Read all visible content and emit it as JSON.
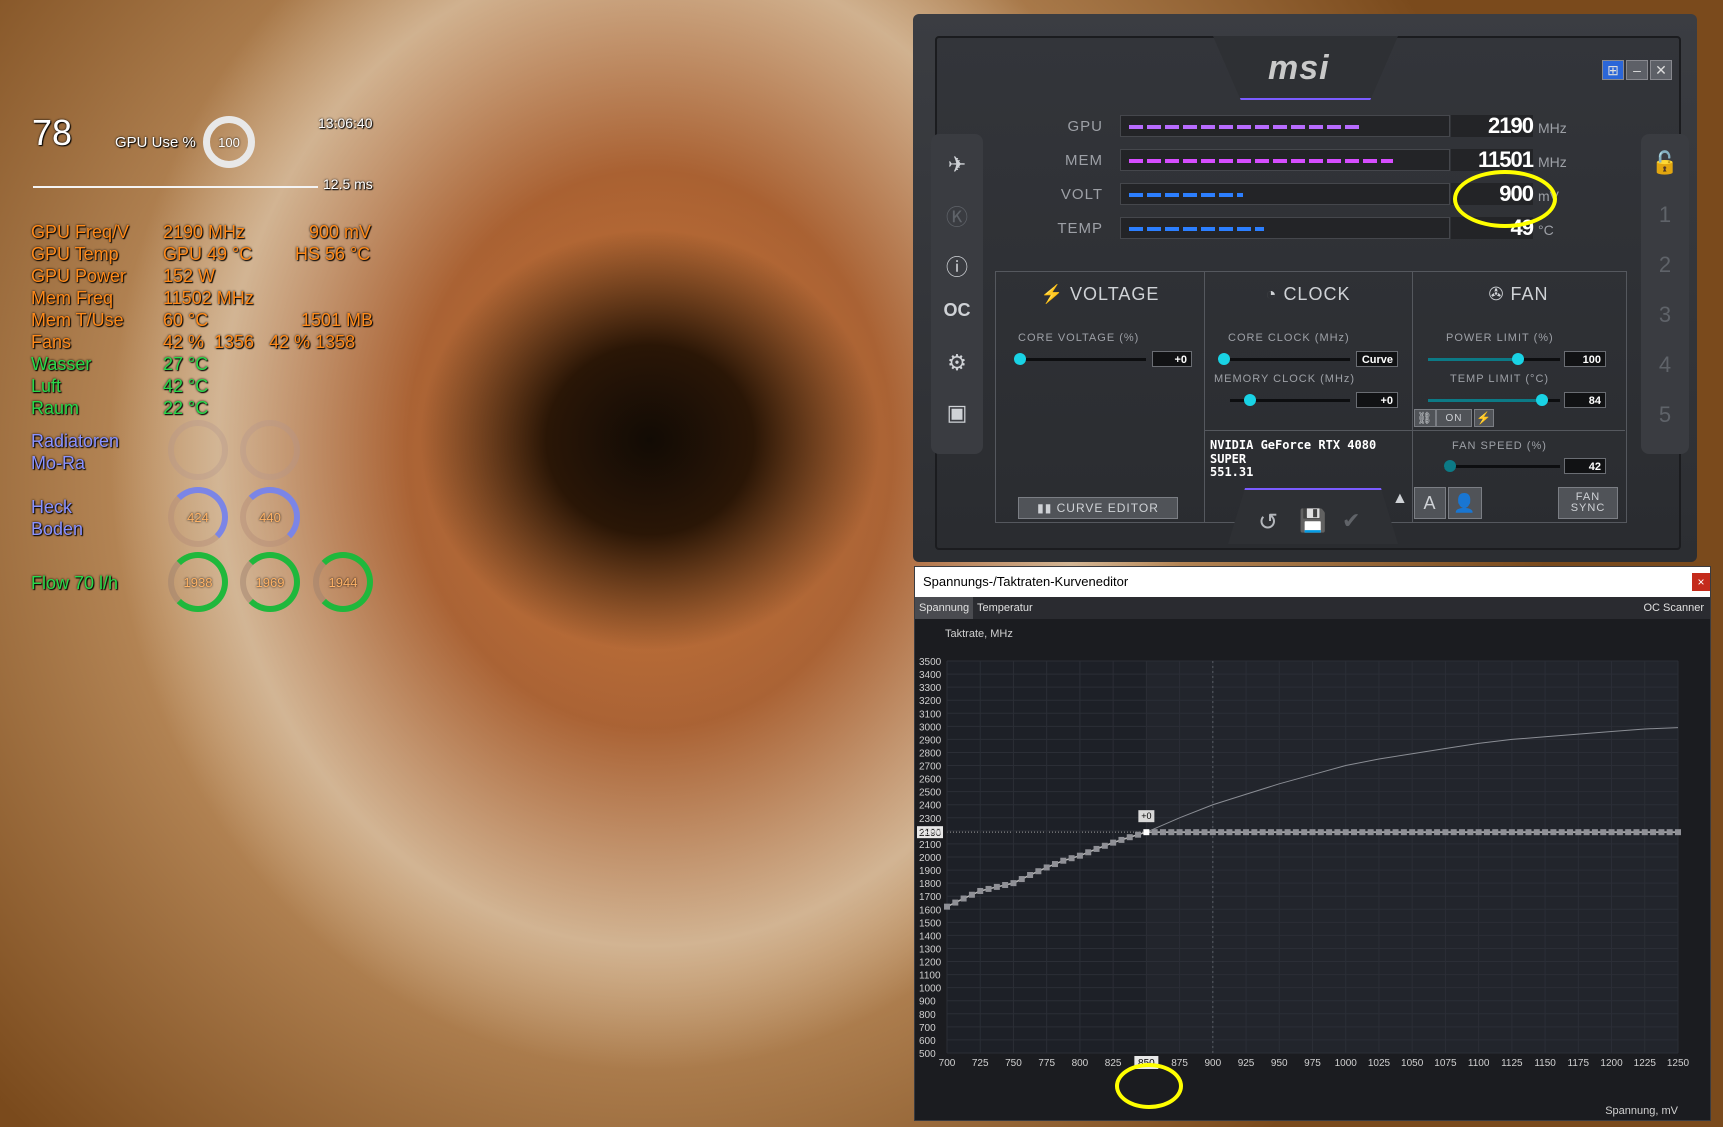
{
  "osd": {
    "fps": "78",
    "gpu_use_label": "GPU Use %",
    "gpu_use_value": "100",
    "time": "13:06:40",
    "frametime": "12.5 ms",
    "rows": [
      {
        "label": "GPU Freq/V",
        "v1": "2190 MHz",
        "v2": "900 mV",
        "color": "orange"
      },
      {
        "label": "GPU Temp",
        "v1": "GPU 49 °C",
        "v2": "HS 56 °C",
        "color": "orange"
      },
      {
        "label": "GPU Power",
        "v1": "152 W",
        "v2": "",
        "color": "orange"
      },
      {
        "label": "Mem Freq",
        "v1": "11502 MHz",
        "v2": "",
        "color": "orange"
      },
      {
        "label": "Mem T/Use",
        "v1": "60 °C",
        "v2": "1501 MB",
        "color": "orange"
      },
      {
        "label": "Fans",
        "v1": "42 %  1356   42 % 1358",
        "v2": "",
        "color": "orange"
      },
      {
        "label": "Wasser",
        "v1": "27 °C",
        "v2": "",
        "color": "green"
      },
      {
        "label": "Luft",
        "v1": "42 °C",
        "v2": "",
        "color": "green"
      },
      {
        "label": "Raum",
        "v1": "22 °C",
        "v2": "",
        "color": "green"
      }
    ],
    "radiatoren_label": "Radiatoren",
    "mora_label": "Mo-Ra",
    "heck_label": "Heck",
    "boden_label": "Boden",
    "heck_values": [
      "424",
      "440"
    ],
    "flow_label": "Flow 70 l/h",
    "flow_values": [
      "1938",
      "1969",
      "1944"
    ]
  },
  "afterburner": {
    "logo": "msi",
    "monitors": [
      {
        "label": "GPU",
        "value": "2190",
        "unit": "MHz",
        "fill": 0.77,
        "color": "#b86cff"
      },
      {
        "label": "MEM",
        "value": "11501",
        "unit": "MHz",
        "fill": 0.88,
        "color": "#d64dff"
      },
      {
        "label": "VOLT",
        "value": "900",
        "unit": "mV",
        "fill": 0.38,
        "color": "#2c7fff"
      },
      {
        "label": "TEMP",
        "value": "49",
        "unit": "°C",
        "fill": 0.45,
        "color": "#2c7fff"
      }
    ],
    "voltage_head": "VOLTAGE",
    "clock_head": "CLOCK",
    "fan_head": "FAN",
    "core_voltage_label": "CORE VOLTAGE (%)",
    "core_voltage_value": "+0",
    "core_clock_label": "CORE CLOCK (MHz)",
    "core_clock_value": "Curve",
    "memory_clock_label": "MEMORY CLOCK (MHz)",
    "memory_clock_value": "+0",
    "power_limit_label": "POWER LIMIT (%)",
    "power_limit_value": "100",
    "temp_limit_label": "TEMP LIMIT (°C)",
    "temp_limit_value": "84",
    "link_on": "ON",
    "fan_speed_label": "FAN SPEED (%)",
    "fan_speed_value": "42",
    "gpu_name": "NVIDIA GeForce RTX 4080 SUPER",
    "driver": "551.31",
    "curve_editor_btn": "CURVE EDITOR",
    "fan_sync_btn": "FAN\nSYNC",
    "profiles": [
      "1",
      "2",
      "3",
      "4",
      "5"
    ],
    "accent": "#19d3e5"
  },
  "curve_editor": {
    "title": "Spannungs-/Taktraten-Kurveneditor",
    "tab_voltage": "Spannung",
    "tab_temperature": "Temperatur",
    "oc_scanner": "OC Scanner",
    "close": "×",
    "y_axis_label": "Taktrate, MHz",
    "x_axis_label": "Spannung, mV",
    "current_clock": "2190",
    "current_voltage": "850",
    "offset_label": "+0"
  },
  "chart_data": {
    "type": "line",
    "title": "Spannungs-/Taktraten-Kurveneditor",
    "xlabel": "Spannung, mV",
    "ylabel": "Taktrate, MHz",
    "xlim": [
      700,
      1250
    ],
    "ylim": [
      500,
      3500
    ],
    "x_ticks": [
      "700",
      "725",
      "750",
      "775",
      "800",
      "825",
      "850",
      "875",
      "900",
      "925",
      "950",
      "975",
      "1000",
      "1025",
      "1050",
      "1075",
      "1100",
      "1125",
      "1150",
      "1175",
      "1200",
      "1225",
      "1250"
    ],
    "y_ticks": [
      "500",
      "600",
      "700",
      "800",
      "900",
      "1000",
      "1100",
      "1200",
      "1300",
      "1400",
      "1500",
      "1600",
      "1700",
      "1800",
      "1900",
      "2000",
      "2100",
      "2190",
      "2200",
      "2300",
      "2400",
      "2500",
      "2600",
      "2700",
      "2800",
      "2900",
      "3000",
      "3100",
      "3200",
      "3300",
      "3400",
      "3500"
    ],
    "series": [
      {
        "values_x": [
          700,
          712,
          725,
          737,
          750,
          762,
          775,
          787,
          800,
          812,
          825,
          837,
          850,
          875,
          900,
          925,
          950,
          975,
          1000,
          1025,
          1050,
          1075,
          1100,
          1125,
          1150,
          1175,
          1200,
          1225,
          1250
        ],
        "values_y": [
          1620,
          1680,
          1740,
          1770,
          1800,
          1860,
          1920,
          1970,
          2010,
          2060,
          2110,
          2150,
          2190,
          2190,
          2190,
          2190,
          2190,
          2190,
          2190,
          2190,
          2190,
          2190,
          2190,
          2190,
          2190,
          2190,
          2190,
          2190,
          2190
        ]
      },
      {
        "values_x": [
          850,
          875,
          900,
          925,
          950,
          975,
          1000,
          1025,
          1050,
          1075,
          1100,
          1125,
          1150,
          1175,
          1200,
          1225,
          1250
        ],
        "values_y": [
          2190,
          2300,
          2400,
          2480,
          2560,
          2630,
          2700,
          2750,
          2790,
          2830,
          2870,
          2900,
          2920,
          2940,
          2960,
          2980,
          2990
        ]
      }
    ]
  }
}
